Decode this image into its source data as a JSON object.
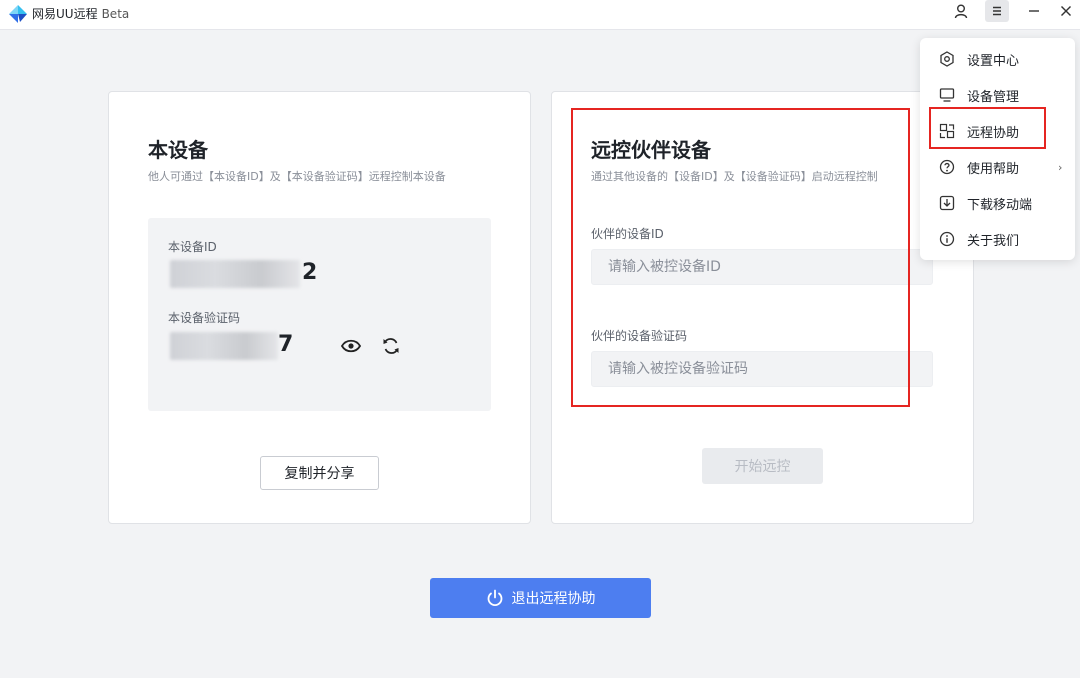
{
  "titlebar": {
    "app_name": "网易UU远程",
    "beta_label": "Beta"
  },
  "local_device": {
    "title": "本设备",
    "subtitle": "他人可通过【本设备ID】及【本设备验证码】远程控制本设备",
    "id_label": "本设备ID",
    "id_visible_tail": "2",
    "code_label": "本设备验证码",
    "code_visible_tail": "7",
    "copy_button": "复制并分享"
  },
  "partner_device": {
    "title": "远控伙伴设备",
    "subtitle": "通过其他设备的【设备ID】及【设备验证码】启动远程控制",
    "id_label": "伙伴的设备ID",
    "id_placeholder": "请输入被控设备ID",
    "code_label": "伙伴的设备验证码",
    "code_placeholder": "请输入被控设备验证码",
    "start_button": "开始远控"
  },
  "exit_button": "退出远程协助",
  "menu": {
    "items": [
      {
        "label": "设置中心",
        "icon": "settings-icon"
      },
      {
        "label": "设备管理",
        "icon": "monitor-icon"
      },
      {
        "label": "远程协助",
        "icon": "remote-assist-icon"
      },
      {
        "label": "使用帮助",
        "icon": "help-icon",
        "submenu_arrow": "›"
      },
      {
        "label": "下载移动端",
        "icon": "download-icon"
      },
      {
        "label": "关于我们",
        "icon": "info-icon"
      }
    ]
  },
  "colors": {
    "accent": "#4d7ef0",
    "highlight_red": "#e52521",
    "background": "#f2f3f5"
  }
}
